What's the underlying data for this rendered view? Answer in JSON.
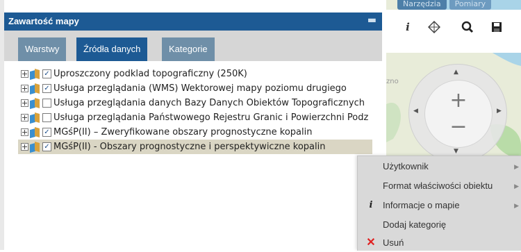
{
  "panel": {
    "title": "Zawartość mapy",
    "collapse_icon": "minus-icon",
    "tabs": [
      {
        "label": "Warstwy",
        "active": false
      },
      {
        "label": "Źródła danych",
        "active": true
      },
      {
        "label": "Kategorie",
        "active": false
      }
    ]
  },
  "layers": [
    {
      "label": "Uproszczony podklad topograficzny (250K)",
      "checked": true,
      "selected": false
    },
    {
      "label": "Usługa przeglądania (WMS) Wektorowej mapy poziomu drugiego",
      "checked": true,
      "selected": false
    },
    {
      "label": "Usługa przeglądania danych Bazy Danych Obiektów Topograficznych",
      "checked": false,
      "selected": false
    },
    {
      "label": "Usługa przeglądania Państwowego Rejestru Granic i Powierzchni Podz",
      "checked": false,
      "selected": false
    },
    {
      "label": "MGśP(II) – Zweryfikowane obszary prognostyczne kopalin",
      "checked": true,
      "selected": false
    },
    {
      "label": "MGśP(II) - Obszary prognostyczne i perspektywiczne kopalin",
      "checked": true,
      "selected": true
    }
  ],
  "map": {
    "tabs": [
      "Narzędzia",
      "Pomiary"
    ],
    "toolbar": [
      "info-icon",
      "layers-cube-icon",
      "zoom-magnifier-icon",
      "save-floppy-icon"
    ],
    "label_fragment": "zno",
    "zoom_in": "+",
    "zoom_out": "−"
  },
  "context_menu": {
    "items": [
      {
        "label": "Użytkownik",
        "icon": "",
        "submenu": true
      },
      {
        "label": "Format właściwości obiektu",
        "icon": "",
        "submenu": true
      },
      {
        "label": "Informacje o mapie",
        "icon": "info-icon",
        "submenu": true
      },
      {
        "label": "Dodaj kategorię",
        "icon": "",
        "submenu": false
      },
      {
        "label": "Usuń",
        "icon": "delete-x-icon",
        "submenu": false
      }
    ]
  },
  "colors": {
    "header_blue": "#1d5a94",
    "tab_inactive": "#6f8fa8",
    "selected_row": "#dad6c4",
    "menu_bg": "#d9d9d9",
    "delete_red": "#e02020"
  }
}
